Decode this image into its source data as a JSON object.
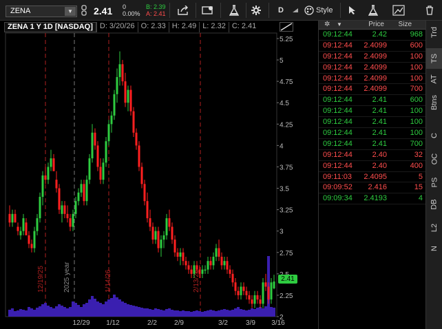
{
  "toolbar": {
    "symbol": "ZENA",
    "last": "2.41",
    "change": "0",
    "change_pct": "0.00%",
    "bid": "B: 2.39",
    "ask": "A: 2.41",
    "aggregation": "D",
    "style_label": "Style"
  },
  "chart": {
    "title": "ZENA 1 Y 1D [NASDAQ]",
    "date": "D: 3/20/26",
    "open": "O: 2.33",
    "high": "H: 2.49",
    "low": "L: 2.32",
    "close": "C: 2.41",
    "last_price_tag": "2.41",
    "y_ticks": [
      "5.25",
      "5",
      "4.75",
      "4.5",
      "4.25",
      "4",
      "3.75",
      "3.5",
      "3.25",
      "3",
      "2.75",
      "2.5",
      "2.25",
      "2"
    ],
    "x_ticks": [
      "12/29",
      "1/12",
      "2/2",
      "2/9",
      "3/2",
      "3/9",
      "3/16"
    ],
    "event_labels": [
      "12/19/25",
      "2025 year",
      "1/14/26",
      "2/13/26"
    ],
    "colors": {
      "up": "#2ecc40",
      "down": "#ff2020",
      "volume": "#3a1fb0",
      "event": "#b02020"
    }
  },
  "time_sales": {
    "headers": [
      "Price",
      "Size"
    ],
    "rows": [
      {
        "time": "09:12:44",
        "price": "2.42",
        "size": "968",
        "dir": "up"
      },
      {
        "time": "09:12:44",
        "price": "2.4099",
        "size": "600",
        "dir": "dn"
      },
      {
        "time": "09:12:44",
        "price": "2.4099",
        "size": "100",
        "dir": "dn"
      },
      {
        "time": "09:12:44",
        "price": "2.4099",
        "size": "100",
        "dir": "dn"
      },
      {
        "time": "09:12:44",
        "price": "2.4099",
        "size": "100",
        "dir": "dn"
      },
      {
        "time": "09:12:44",
        "price": "2.4099",
        "size": "700",
        "dir": "dn"
      },
      {
        "time": "09:12:44",
        "price": "2.41",
        "size": "600",
        "dir": "up"
      },
      {
        "time": "09:12:44",
        "price": "2.41",
        "size": "100",
        "dir": "up"
      },
      {
        "time": "09:12:44",
        "price": "2.41",
        "size": "100",
        "dir": "up"
      },
      {
        "time": "09:12:44",
        "price": "2.41",
        "size": "100",
        "dir": "up"
      },
      {
        "time": "09:12:44",
        "price": "2.41",
        "size": "700",
        "dir": "up"
      },
      {
        "time": "09:12:44",
        "price": "2.40",
        "size": "32",
        "dir": "dn"
      },
      {
        "time": "09:12:44",
        "price": "2.40",
        "size": "400",
        "dir": "dn"
      },
      {
        "time": "09:11:03",
        "price": "2.4095",
        "size": "5",
        "dir": "dn"
      },
      {
        "time": "09:09:52",
        "price": "2.416",
        "size": "15",
        "dir": "dn"
      },
      {
        "time": "09:09:34",
        "price": "2.4193",
        "size": "4",
        "dir": "up"
      }
    ]
  },
  "tabs": [
    "Trd",
    "TS",
    "AT",
    "Btns",
    "C",
    "OC",
    "PS",
    "DB",
    "L2",
    "N"
  ],
  "active_tab": "TS"
}
